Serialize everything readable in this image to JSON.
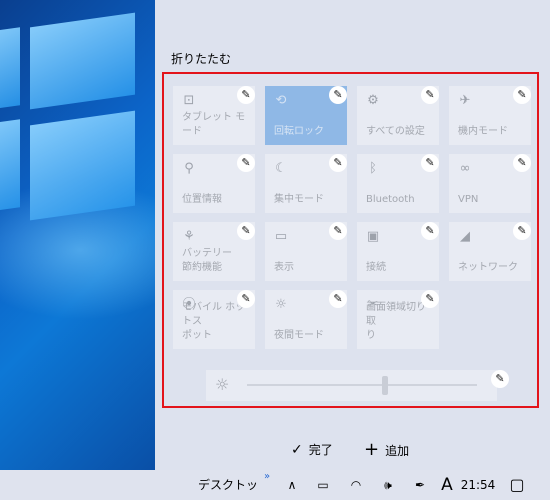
{
  "action_center": {
    "collapse_label": "折りたたむ",
    "tiles": [
      {
        "label": "タブレット モード",
        "icon": "tablet-mode-icon",
        "glyph": "⊡",
        "active": false
      },
      {
        "label": "回転ロック",
        "icon": "rotation-lock-icon",
        "glyph": "⟲",
        "active": true
      },
      {
        "label": "すべての設定",
        "icon": "settings-gear-icon",
        "glyph": "⚙",
        "active": false
      },
      {
        "label": "機内モード",
        "icon": "airplane-icon",
        "glyph": "✈",
        "active": false
      },
      {
        "label": "位置情報",
        "icon": "location-icon",
        "glyph": "⚲",
        "active": false
      },
      {
        "label": "集中モード",
        "icon": "moon-icon",
        "glyph": "☾",
        "active": false
      },
      {
        "label": "Bluetooth",
        "icon": "bluetooth-icon",
        "glyph": "ᛒ",
        "active": false
      },
      {
        "label": "VPN",
        "icon": "vpn-icon",
        "glyph": "∞",
        "active": false
      },
      {
        "label": "バッテリー\n節約機能",
        "icon": "battery-saver-icon",
        "glyph": "⚘",
        "active": false
      },
      {
        "label": "表示",
        "icon": "project-display-icon",
        "glyph": "▭",
        "active": false
      },
      {
        "label": "接続",
        "icon": "connect-icon",
        "glyph": "▣",
        "active": false
      },
      {
        "label": "ネットワーク",
        "icon": "network-icon",
        "glyph": "◢",
        "active": false
      },
      {
        "label": "モバイル ホットス\nポット",
        "icon": "mobile-hotspot-icon",
        "glyph": "⦿",
        "active": false
      },
      {
        "label": "夜間モード",
        "icon": "night-light-icon",
        "glyph": "☼",
        "active": false
      },
      {
        "label": "画面領域切り取\nり",
        "icon": "screen-snip-icon",
        "glyph": "✂",
        "active": false
      }
    ],
    "pin_glyph": "✎",
    "brightness": {
      "icon": "brightness-sun-icon",
      "glyph": "☼",
      "level": 0.6
    },
    "done_label": "完了",
    "done_icon": "✓",
    "add_label": "追加",
    "add_icon": "+"
  },
  "taskbar": {
    "desktop_label": "デスクトップ",
    "more_glyph": "»",
    "up_glyph": "∧",
    "battery_glyph": "▭",
    "wifi_glyph": "◠",
    "volume_glyph": "🕪",
    "pen_glyph": "✒",
    "ime_label": "A",
    "time": "21:54",
    "notification_glyph": "▢"
  },
  "colors": {
    "highlight_border": "#e3141b",
    "active_tile": "#8fb8e6",
    "panel_bg": "#dde2ee"
  }
}
